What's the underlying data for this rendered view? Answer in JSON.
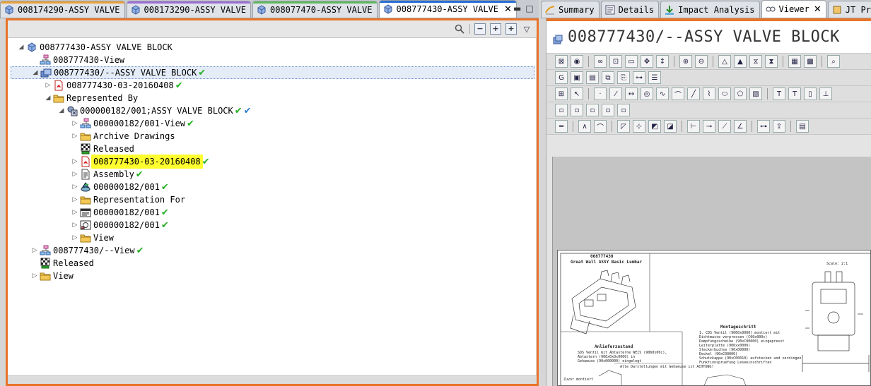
{
  "left_tabs": [
    {
      "label": "008174290-ASSY VALVE",
      "accent": "#e8a13a",
      "active": false
    },
    {
      "label": "008173290-ASSY VALVE",
      "accent": "#9b6fd6",
      "active": false
    },
    {
      "label": "008077470-ASSY VALVE",
      "accent": "#5fb85f",
      "active": false
    },
    {
      "label": "008777430-ASSY VALVE",
      "accent": "#2a6fd4",
      "active": true
    }
  ],
  "right_tabs": [
    {
      "label": "Summary",
      "icon": "summary-icon"
    },
    {
      "label": "Details",
      "icon": "details-icon"
    },
    {
      "label": "Impact Analysis",
      "icon": "impact-analysis-icon"
    },
    {
      "label": "Viewer",
      "icon": "viewer-icon",
      "active": true
    },
    {
      "label": "JT Prev",
      "icon": "jt-preview-icon"
    }
  ],
  "tree": [
    {
      "level": 0,
      "twisty": "open",
      "icon": "assembly-icon",
      "label": "008777430-ASSY VALVE BLOCK",
      "status": []
    },
    {
      "level": 1,
      "twisty": "none",
      "icon": "bom-view-icon",
      "label": "008777430-View",
      "status": []
    },
    {
      "level": 1,
      "twisty": "open",
      "icon": "item-revision-icon",
      "label": "008777430/--ASSY VALVE BLOCK",
      "status": [
        "released"
      ],
      "selected": true
    },
    {
      "level": 2,
      "twisty": "closed",
      "icon": "pdf-icon",
      "label": "008777430-03-20160408",
      "status": [
        "released"
      ]
    },
    {
      "level": 2,
      "twisty": "open",
      "icon": "folder-icon",
      "label": "Represented By",
      "status": []
    },
    {
      "level": 3,
      "twisty": "open",
      "icon": "cad-assembly-icon",
      "label": "000000182/001;ASSY VALVE BLOCK",
      "status": [
        "released",
        "checked"
      ]
    },
    {
      "level": 4,
      "twisty": "closed",
      "icon": "bom-view-icon",
      "label": "000000182/001-View",
      "status": [
        "released"
      ]
    },
    {
      "level": 4,
      "twisty": "closed",
      "icon": "folder-icon",
      "label": "Archive Drawings",
      "status": []
    },
    {
      "level": 4,
      "twisty": "none",
      "icon": "release-status-icon",
      "label": "Released",
      "status": []
    },
    {
      "level": 4,
      "twisty": "closed",
      "icon": "pdf-icon",
      "label": "008777430-03-20160408",
      "status": [
        "released"
      ],
      "highlight": true
    },
    {
      "level": 4,
      "twisty": "closed",
      "icon": "document-icon",
      "label": "Assembly",
      "status": [
        "released"
      ]
    },
    {
      "level": 4,
      "twisty": "closed",
      "icon": "cad-model-icon",
      "label": "000000182/001",
      "status": [
        "released"
      ]
    },
    {
      "level": 4,
      "twisty": "closed",
      "icon": "folder-icon",
      "label": "Representation For",
      "status": []
    },
    {
      "level": 4,
      "twisty": "closed",
      "icon": "drawing-icon",
      "label": "000000182/001",
      "status": [
        "released"
      ]
    },
    {
      "level": 4,
      "twisty": "closed",
      "icon": "drawing-sheet-icon",
      "label": "000000182/001",
      "status": [
        "released"
      ]
    },
    {
      "level": 4,
      "twisty": "closed",
      "icon": "folder-icon",
      "label": "View",
      "status": []
    },
    {
      "level": 1,
      "twisty": "closed",
      "icon": "bom-view-icon",
      "label": "008777430/--View",
      "status": [
        "released"
      ]
    },
    {
      "level": 1,
      "twisty": "none",
      "icon": "release-status-icon",
      "label": "Released",
      "status": []
    },
    {
      "level": 1,
      "twisty": "closed",
      "icon": "folder-icon",
      "label": "View",
      "status": []
    }
  ],
  "viewer": {
    "title": "008777430/--ASSY VALVE BLOCK"
  },
  "drawing": {
    "part_number": "008777430",
    "subtitle": "Great Wall ASSY Basic Lumbar",
    "scale": "Scale: 2:1",
    "section_title": "Montageschritt",
    "section_lines": [
      "1. CDS Ventil (9060x0000) montiert mit",
      "Dichtmasse verpressen (C00x000x)",
      "Dampfungsscheibe (90xC00000) eingepresst",
      "Leiterplatte (906xx0000)",
      "Steckerbuchse (90x00000)",
      "Deckel (90xC00000)",
      "Schutzkappe (90xC00010) aufstecken und verdingen",
      "Funktionspruefung Leseeinschriften"
    ],
    "delivery_title": "Anlieferzustand",
    "delivery_lines": [
      "SDS Ventil mit Abtasterne WEIS (9060x00c),",
      "Abtastern (906x0x0x0000) in",
      "Gehaeuse (90x000000) eingelegt"
    ],
    "note_1": "Alle Darstellungen mit Gehaeuse ist ACHTUNG!",
    "note_2": "Zuvor montiert"
  },
  "colors": {
    "accent_orange": "#e8742a",
    "status_green": "#22b022",
    "status_blue": "#2a7bd4",
    "highlight_yellow": "#ffff30"
  }
}
